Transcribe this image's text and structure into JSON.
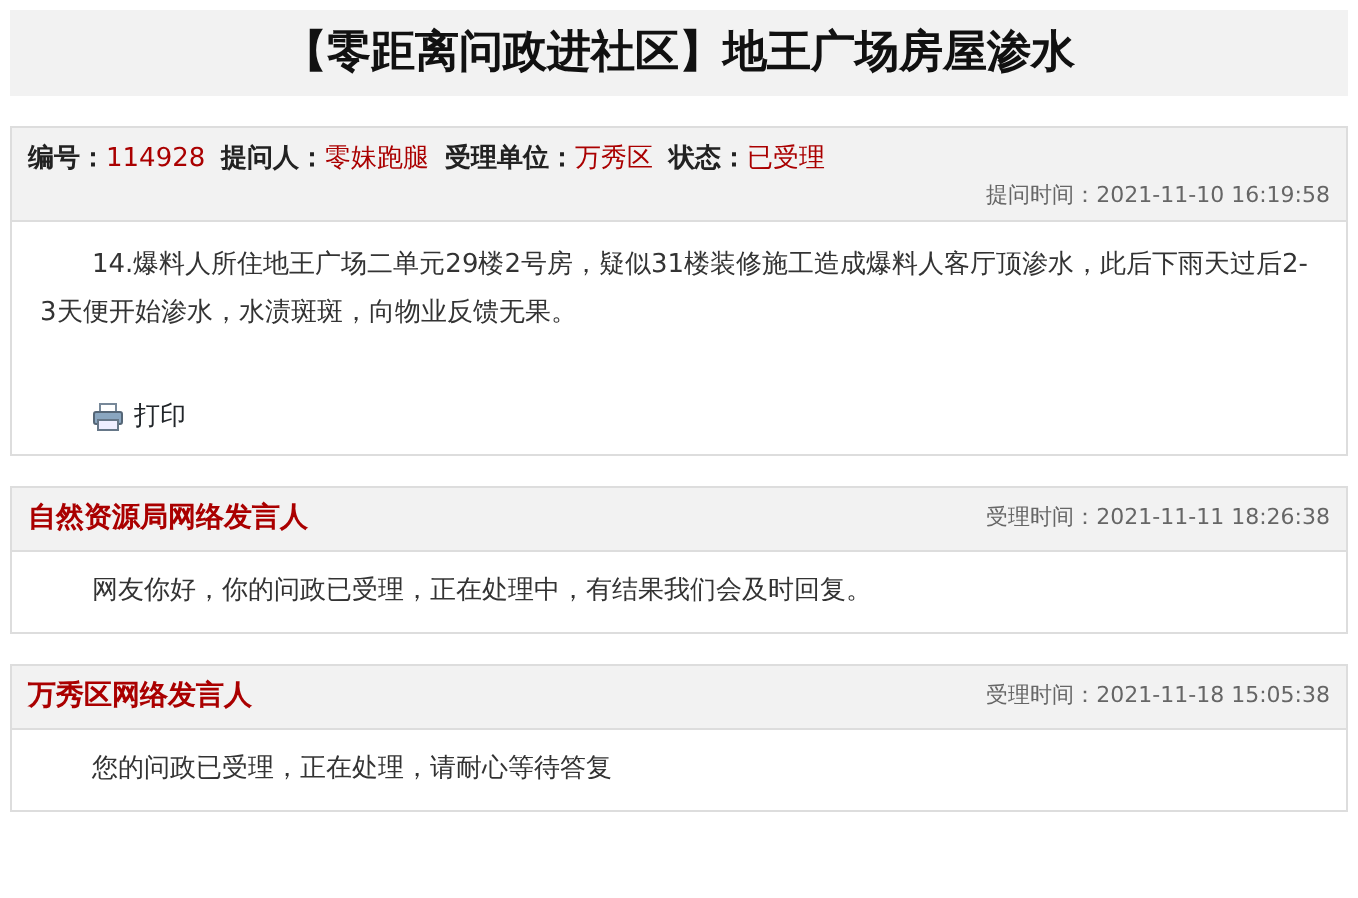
{
  "title": "【零距离问政进社区】地王广场房屋渗水",
  "question": {
    "meta": [
      {
        "label": "编号：",
        "value": "114928"
      },
      {
        "label": "提问人：",
        "value": "零妹跑腿"
      },
      {
        "label": "受理单位：",
        "value": "万秀区"
      },
      {
        "label": "状态：",
        "value": "已受理"
      }
    ],
    "time": "提问时间：2021-11-10 16:19:58",
    "body": "14.爆料人所住地王广场二单元29楼2号房，疑似31楼装修施工造成爆料人客厅顶渗水，此后下雨天过后2-3天便开始渗水，水渍斑斑，向物业反馈无果。",
    "print": "打印"
  },
  "replies": [
    {
      "author": "自然资源局网络发言人",
      "time": "受理时间：2021-11-11 18:26:38",
      "body": "网友你好，你的问政已受理，正在处理中，有结果我们会及时回复。"
    },
    {
      "author": "万秀区网络发言人",
      "time": "受理时间：2021-11-18 15:05:38",
      "body": "您的问政已受理，正在处理，请耐心等待答复"
    }
  ]
}
